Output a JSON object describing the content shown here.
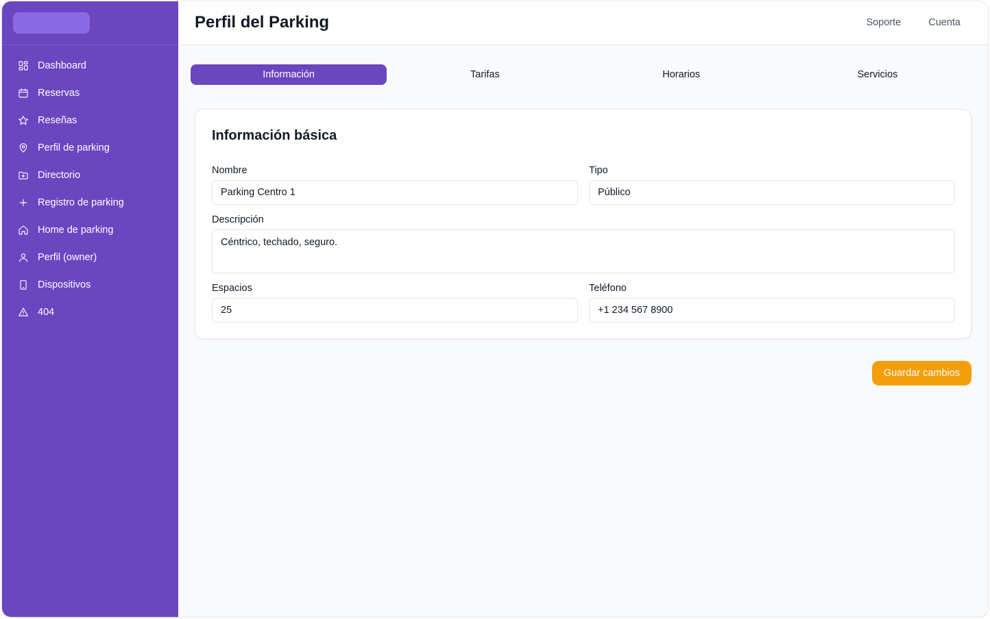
{
  "header": {
    "title": "Perfil del Parking",
    "links": [
      "Soporte",
      "Cuenta"
    ]
  },
  "sidebar": {
    "items": [
      {
        "label": "Dashboard",
        "icon": "dashboard-grid-icon"
      },
      {
        "label": "Reservas",
        "icon": "calendar-icon"
      },
      {
        "label": "Reseñas",
        "icon": "star-icon"
      },
      {
        "label": "Perfil de parking",
        "icon": "map-pin-icon"
      },
      {
        "label": "Directorio",
        "icon": "folder-plus-icon"
      },
      {
        "label": "Registro de parking",
        "icon": "plus-icon"
      },
      {
        "label": "Home de parking",
        "icon": "home-icon"
      },
      {
        "label": "Perfil (owner)",
        "icon": "user-icon"
      },
      {
        "label": "Dispositivos",
        "icon": "device-icon"
      },
      {
        "label": "404",
        "icon": "warning-icon"
      }
    ]
  },
  "tabs": [
    {
      "label": "Información",
      "active": true
    },
    {
      "label": "Tarifas",
      "active": false
    },
    {
      "label": "Horarios",
      "active": false
    },
    {
      "label": "Servicios",
      "active": false
    }
  ],
  "form": {
    "title": "Información básica",
    "nombre": {
      "label": "Nombre",
      "value": "Parking Centro 1"
    },
    "tipo": {
      "label": "Tipo",
      "value": "Público"
    },
    "descripcion": {
      "label": "Descripción",
      "value": "Céntrico, techado, seguro."
    },
    "espacios": {
      "label": "Espacios",
      "value": "25"
    },
    "telefono": {
      "label": "Teléfono",
      "value": "+1 234 567 8900"
    }
  },
  "actions": {
    "save_label": "Guardar cambios"
  },
  "colors": {
    "sidebar": "#6b46c1",
    "accent": "#6b46c1",
    "save_button": "#f59e0b"
  }
}
